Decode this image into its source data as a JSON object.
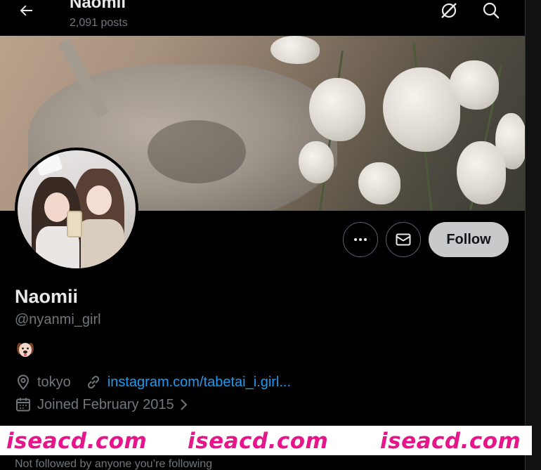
{
  "header": {
    "title": "Naomii",
    "post_count": "2,091 posts",
    "back_icon": "arrow-left-icon",
    "right_icons": [
      "grok-icon",
      "search-icon"
    ]
  },
  "profile": {
    "display_name": "Naomii",
    "handle": "@nyanmi_girl",
    "bio_emoji": "dog-face-icon",
    "location": "tokyo",
    "website": "instagram.com/tabetai_i.girl...",
    "joined": "Joined February 2015",
    "followed_by": "Not followed by anyone you’re following"
  },
  "actions": {
    "more_icon": "more-icon",
    "message_icon": "mail-icon",
    "follow_label": "Follow"
  },
  "watermark": {
    "text_1": "iseacd.com",
    "text_2": "iseacd.com",
    "text_3": "iseacd.com",
    "color": "#e6168a"
  },
  "colors": {
    "background": "#000000",
    "primary_text": "#e7e9ea",
    "secondary_text": "#71767b",
    "link": "#1d9bf0",
    "follow_button_bg": "#c7c9ca"
  }
}
